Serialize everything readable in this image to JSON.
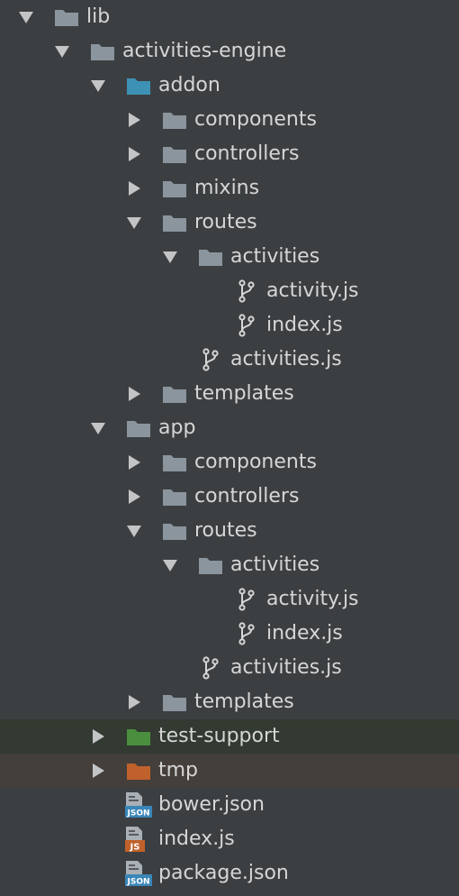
{
  "colors": {
    "background": "#3c3f41",
    "text": "#d6d6d6",
    "folder_default": "#8b959e",
    "folder_source": "#3d91b5",
    "folder_test": "#4a8f3d",
    "folder_excluded": "#c0612b",
    "json_badge": "#3a86b8",
    "js_badge": "#c0612b",
    "highlight_test": "#323a31",
    "highlight_excluded": "#443f3b"
  },
  "tree": {
    "items": [
      {
        "label": "lib",
        "depth": 0,
        "expand": "open",
        "icon": "folder-default-icon"
      },
      {
        "label": "activities-engine",
        "depth": 1,
        "expand": "open",
        "icon": "folder-default-icon"
      },
      {
        "label": "addon",
        "depth": 2,
        "expand": "open",
        "icon": "folder-source-icon"
      },
      {
        "label": "components",
        "depth": 3,
        "expand": "closed",
        "icon": "folder-default-icon"
      },
      {
        "label": "controllers",
        "depth": 3,
        "expand": "closed",
        "icon": "folder-default-icon"
      },
      {
        "label": "mixins",
        "depth": 3,
        "expand": "closed",
        "icon": "folder-default-icon"
      },
      {
        "label": "routes",
        "depth": 3,
        "expand": "open",
        "icon": "folder-default-icon"
      },
      {
        "label": "activities",
        "depth": 4,
        "expand": "open",
        "icon": "folder-default-icon"
      },
      {
        "label": "activity.js",
        "depth": 5,
        "expand": "none",
        "icon": "git-branch-icon"
      },
      {
        "label": "index.js",
        "depth": 5,
        "expand": "none",
        "icon": "git-branch-icon"
      },
      {
        "label": "activities.js",
        "depth": 4,
        "expand": "none",
        "icon": "git-branch-icon"
      },
      {
        "label": "templates",
        "depth": 3,
        "expand": "closed",
        "icon": "folder-default-icon"
      },
      {
        "label": "app",
        "depth": 2,
        "expand": "open",
        "icon": "folder-default-icon"
      },
      {
        "label": "components",
        "depth": 3,
        "expand": "closed",
        "icon": "folder-default-icon"
      },
      {
        "label": "controllers",
        "depth": 3,
        "expand": "closed",
        "icon": "folder-default-icon"
      },
      {
        "label": "routes",
        "depth": 3,
        "expand": "open",
        "icon": "folder-default-icon"
      },
      {
        "label": "activities",
        "depth": 4,
        "expand": "open",
        "icon": "folder-default-icon"
      },
      {
        "label": "activity.js",
        "depth": 5,
        "expand": "none",
        "icon": "git-branch-icon"
      },
      {
        "label": "index.js",
        "depth": 5,
        "expand": "none",
        "icon": "git-branch-icon"
      },
      {
        "label": "activities.js",
        "depth": 4,
        "expand": "none",
        "icon": "git-branch-icon"
      },
      {
        "label": "templates",
        "depth": 3,
        "expand": "closed",
        "icon": "folder-default-icon"
      },
      {
        "label": "test-support",
        "depth": 2,
        "expand": "closed",
        "icon": "folder-test-icon",
        "highlight": "test"
      },
      {
        "label": "tmp",
        "depth": 2,
        "expand": "closed",
        "icon": "folder-excluded-icon",
        "highlight": "excluded"
      },
      {
        "label": "bower.json",
        "depth": 2,
        "expand": "none",
        "icon": "json-file-icon",
        "badge": "JSON"
      },
      {
        "label": "index.js",
        "depth": 2,
        "expand": "none",
        "icon": "js-file-icon",
        "badge": "JS"
      },
      {
        "label": "package.json",
        "depth": 2,
        "expand": "none",
        "icon": "json-file-icon",
        "badge": "JSON"
      }
    ]
  }
}
